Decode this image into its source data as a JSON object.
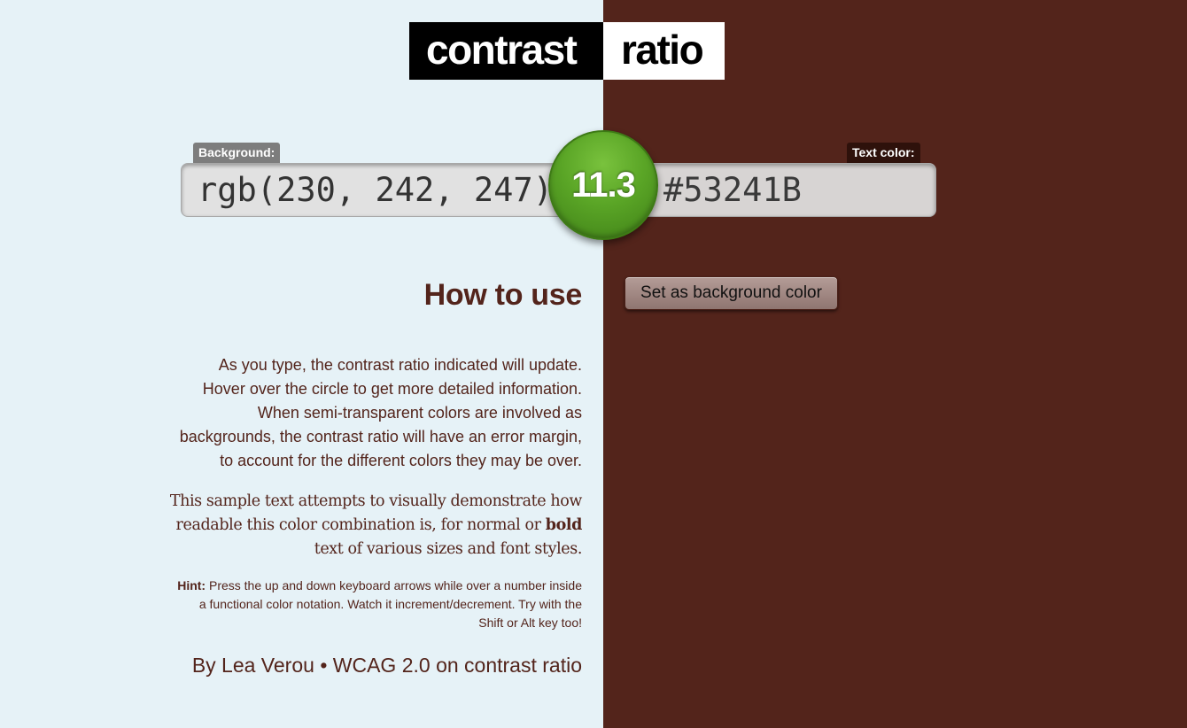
{
  "logo": {
    "word1": "contrast",
    "word2": "ratio"
  },
  "background": {
    "label": "Background:",
    "value": "rgb(230, 242, 247)",
    "color": "#e6f2f7"
  },
  "text_color": {
    "label": "Text color:",
    "value": "#53241B",
    "color": "#53241b"
  },
  "ratio": {
    "value": "11.3",
    "color": "#5aa526"
  },
  "swap_button": {
    "label": "Set as background color"
  },
  "howto": {
    "title": "How to use",
    "p1_lines": [
      "As you type, the contrast ratio indicated will update.",
      "Hover over the circle to get more detailed information.",
      "When semi-transparent colors are involved as",
      "backgrounds, the contrast ratio will have an error margin,",
      "to account for the different colors they may be over."
    ],
    "p2_lines": [
      "This sample text attempts to visually demonstrate how",
      "readable this color combination is, for normal or",
      "bold",
      "text of various sizes and font styles."
    ],
    "hint_label": "Hint:",
    "hint_lines": [
      "Press the up and down keyboard arrows while over a number inside",
      "a functional color notation. Watch it increment/decrement. Try with the",
      "Shift or Alt key too!"
    ]
  },
  "footer": {
    "by": "By",
    "author": "Lea Verou",
    "separator": "•",
    "link": "WCAG 2.0 on contrast ratio"
  }
}
